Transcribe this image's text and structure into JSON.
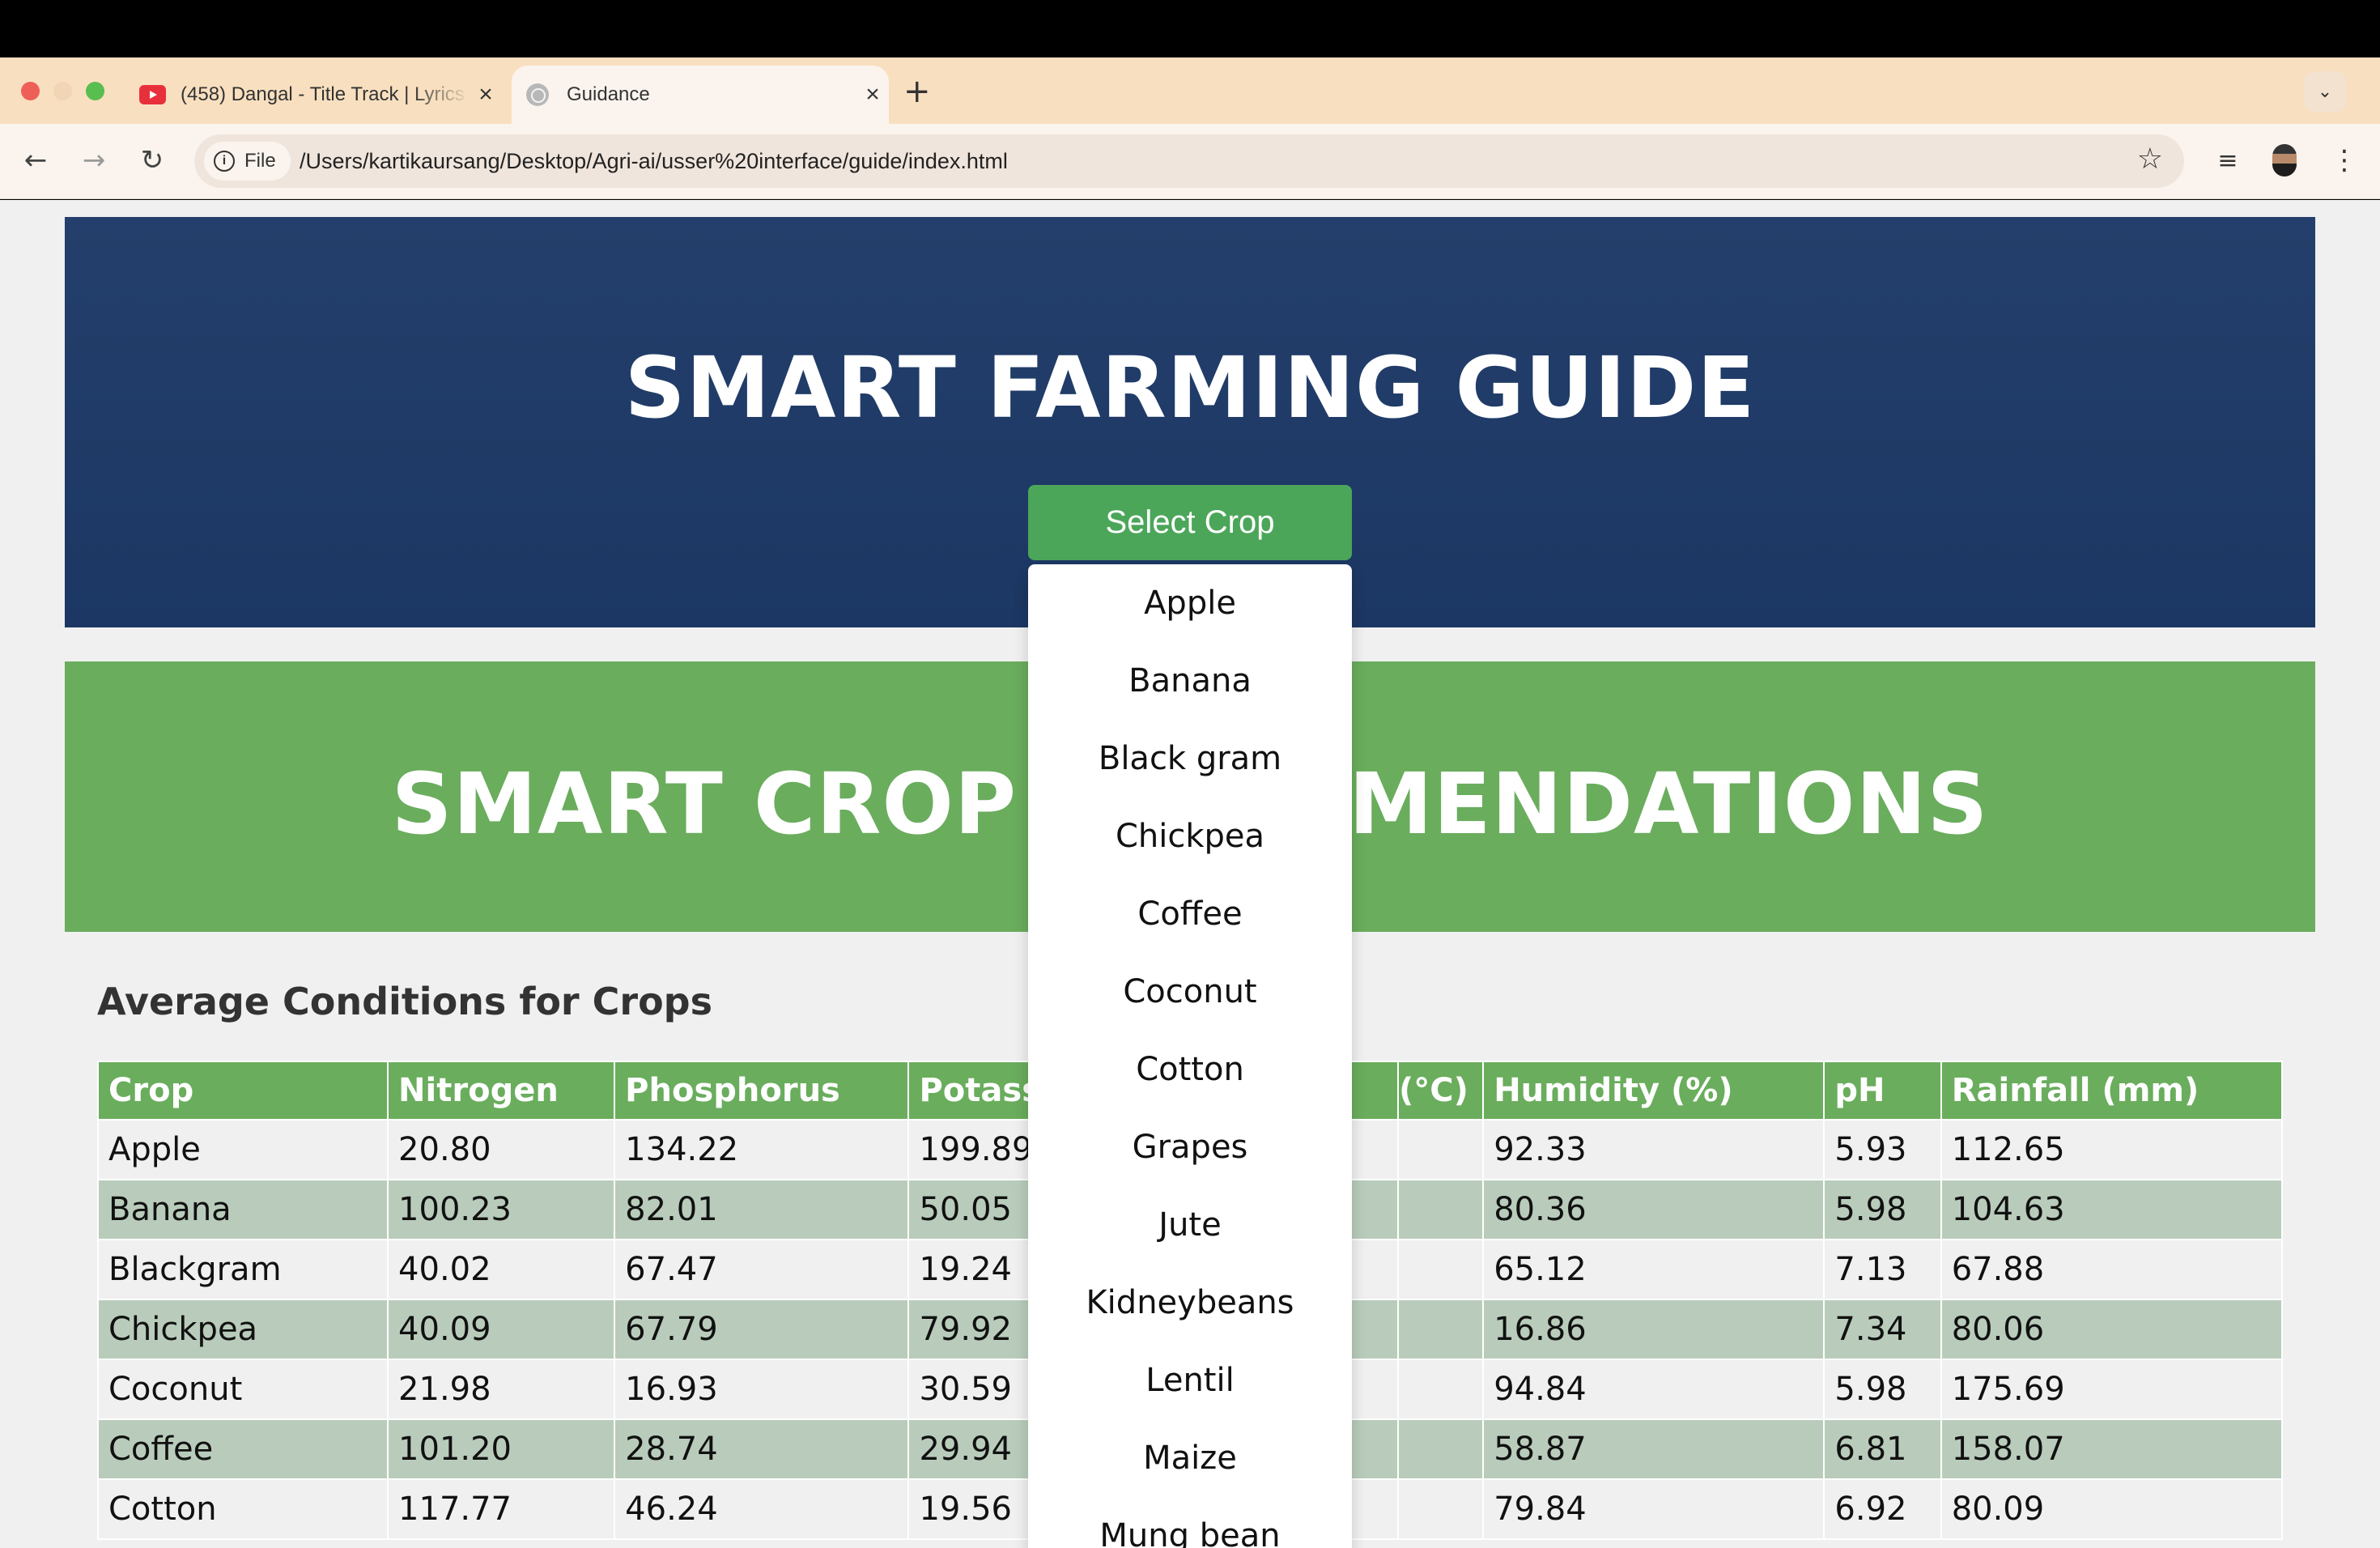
{
  "browser": {
    "tabs": [
      {
        "title": "(458) Dangal - Title Track | Lyrics",
        "icon": "youtube-icon"
      },
      {
        "title": "Guidance",
        "icon": "globe-icon"
      }
    ],
    "chip_label": "File",
    "url": "/Users/kartikaursang/Desktop/Agri-ai/usser%20interface/guide/index.html"
  },
  "page": {
    "hero_title": "SMART FARMING GUIDE",
    "select_button": "Select Crop",
    "dropdown_options": [
      "Apple",
      "Banana",
      "Black gram",
      "Chickpea",
      "Coffee",
      "Coconut",
      "Cotton",
      "Grapes",
      "Jute",
      "Kidneybeans",
      "Lentil",
      "Maize",
      "Mung bean"
    ],
    "banner_left": "SMART CROP",
    "banner_right": "MENDATIONS",
    "section_heading": "Average Conditions for Crops",
    "table": {
      "headers": [
        "Crop",
        "Nitrogen",
        "Phosphorus",
        "Potassium",
        "(°C)",
        "Humidity (%)",
        "pH",
        "Rainfall (mm)"
      ],
      "rows": [
        [
          "Apple",
          "20.80",
          "134.22",
          "199.89",
          "",
          "92.33",
          "5.93",
          "112.65"
        ],
        [
          "Banana",
          "100.23",
          "82.01",
          "50.05",
          "",
          "80.36",
          "5.98",
          "104.63"
        ],
        [
          "Blackgram",
          "40.02",
          "67.47",
          "19.24",
          "",
          "65.12",
          "7.13",
          "67.88"
        ],
        [
          "Chickpea",
          "40.09",
          "67.79",
          "79.92",
          "",
          "16.86",
          "7.34",
          "80.06"
        ],
        [
          "Coconut",
          "21.98",
          "16.93",
          "30.59",
          "",
          "94.84",
          "5.98",
          "175.69"
        ],
        [
          "Coffee",
          "101.20",
          "28.74",
          "29.94",
          "",
          "58.87",
          "6.81",
          "158.07"
        ],
        [
          "Cotton",
          "117.77",
          "46.24",
          "19.56",
          "",
          "79.84",
          "6.92",
          "80.09"
        ]
      ]
    }
  },
  "colors": {
    "hero_bg": "#223d68",
    "green_accent": "#6aad5d",
    "select_button": "#4ca65a",
    "row_alt": "#b9ccbb",
    "tabstrip": "#f8dfbf"
  }
}
